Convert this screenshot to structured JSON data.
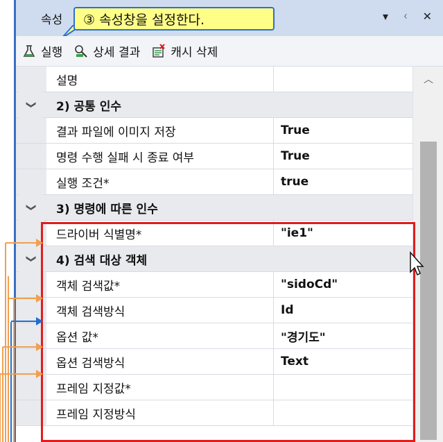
{
  "panel": {
    "title": "속성",
    "controls": {
      "dropdown": "▾",
      "pin": "ᚲ",
      "close": "✕"
    }
  },
  "callout": {
    "text": "③ 속성창을 설정한다."
  },
  "toolbar": {
    "run_label": "실행",
    "details_label": "상세 결과",
    "clear_cache_label": "캐시 삭제"
  },
  "rows": [
    {
      "type": "prop",
      "name": "설명",
      "value": ""
    },
    {
      "type": "cat",
      "name": "2) 공통 인수"
    },
    {
      "type": "prop",
      "name": "결과 파일에 이미지 저장",
      "value": "True"
    },
    {
      "type": "prop",
      "name": "명령 수행 실패 시 종료 여부",
      "value": "True"
    },
    {
      "type": "prop",
      "name": "실행 조건*",
      "value": "true"
    },
    {
      "type": "cat",
      "name": "3) 명령에 따른 인수"
    },
    {
      "type": "prop",
      "name": "드라이버 식별명*",
      "value": "\"ie1\""
    },
    {
      "type": "cat",
      "name": "4) 검색 대상 객체"
    },
    {
      "type": "prop",
      "name": "객체 검색값*",
      "value": "\"sidoCd\""
    },
    {
      "type": "prop",
      "name": "객체 검색방식",
      "value": "Id"
    },
    {
      "type": "prop",
      "name": "옵션 값*",
      "value": "\"경기도\""
    },
    {
      "type": "prop",
      "name": "옵션 검색방식",
      "value": "Text"
    },
    {
      "type": "prop",
      "name": "프레임 지정값*",
      "value": ""
    },
    {
      "type": "prop",
      "name": "프레임 지정방식",
      "value": ""
    }
  ],
  "colors": {
    "accent_border": "#3a6fc4",
    "highlight_box": "#e31b1b",
    "callout_bg": "#ffff88",
    "arrow_orange": "#f0a050",
    "arrow_blue": "#1f6fd0"
  }
}
